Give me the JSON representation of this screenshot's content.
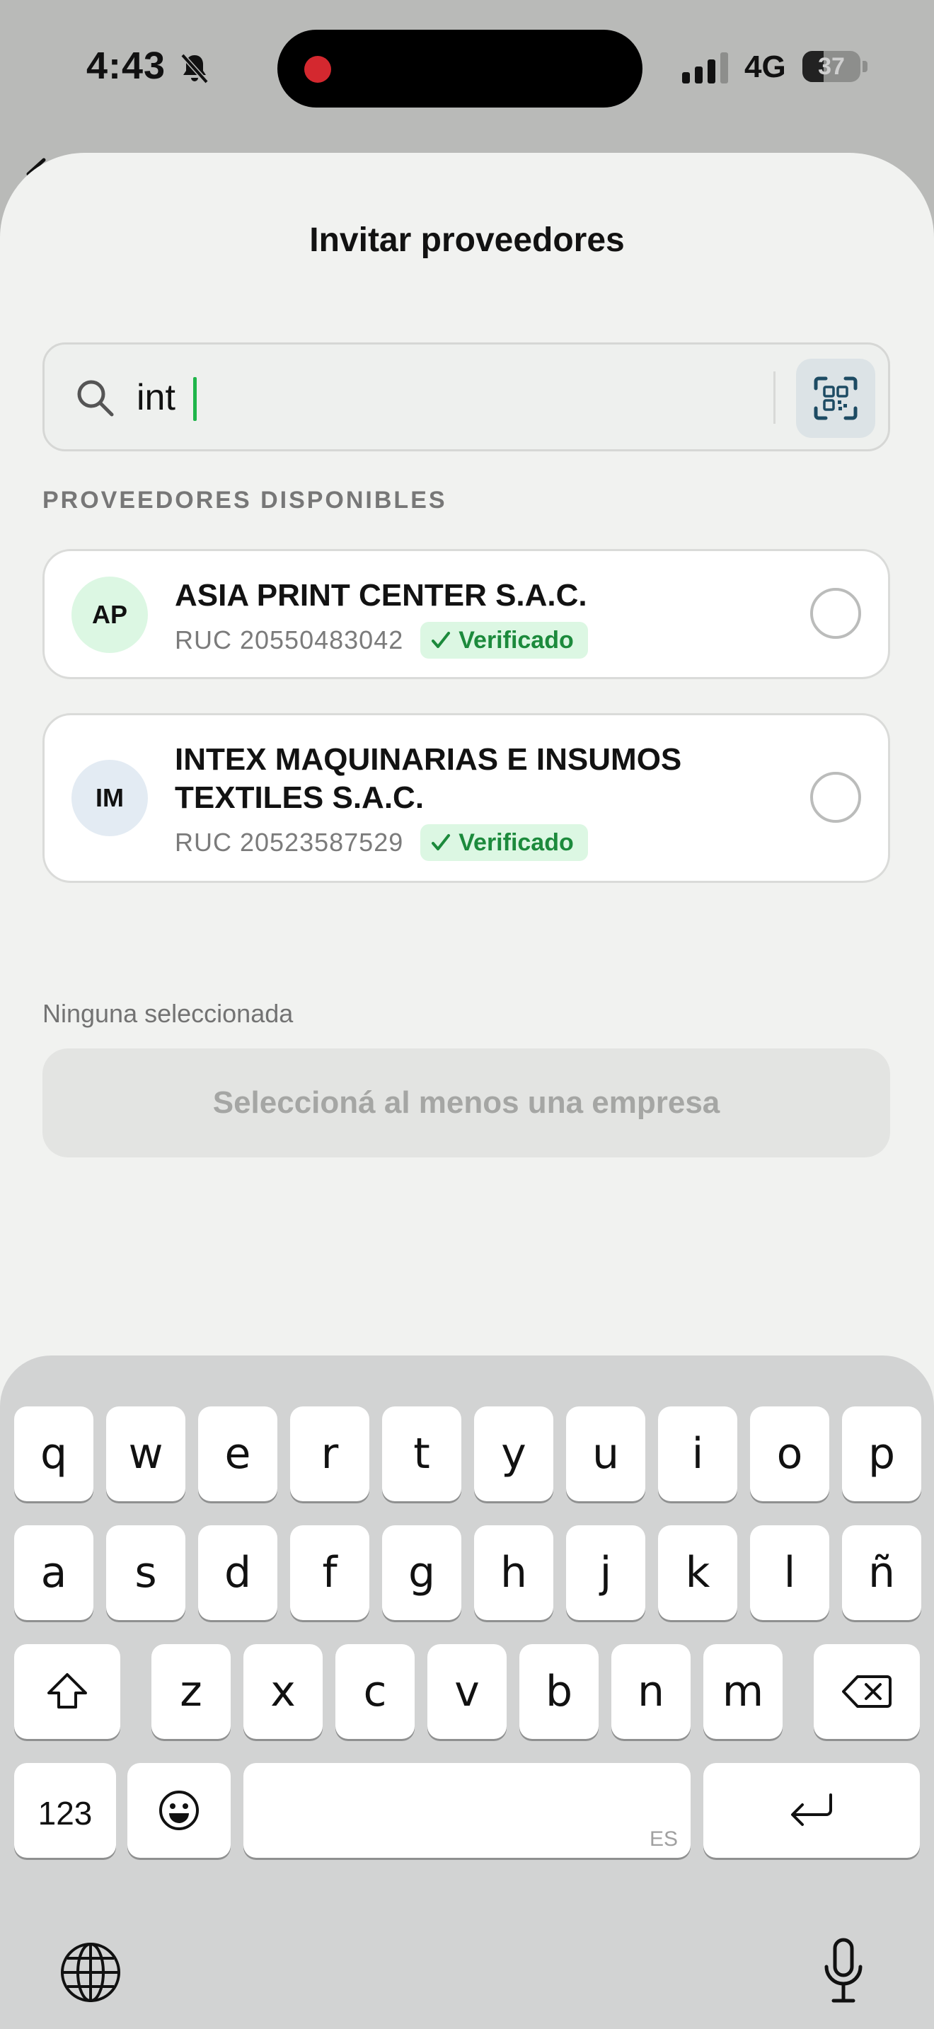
{
  "status_bar": {
    "time": "4:43",
    "network": "4G",
    "battery": "37",
    "battery_level": 0.37
  },
  "sheet": {
    "title": "Invitar proveedores",
    "search": {
      "value": "int",
      "placeholder": ""
    },
    "section_label": "PROVEEDORES DISPONIBLES",
    "suppliers": [
      {
        "initials": "AP",
        "name": "ASIA PRINT CENTER S.A.C.",
        "ruc": "RUC 20550483042",
        "badge": "Verificado",
        "selected": false
      },
      {
        "initials": "IM",
        "name": "INTEX MAQUINARIAS E INSUMOS TEXTILES S.A.C.",
        "ruc": "RUC 20523587529",
        "badge": "Verificado",
        "selected": false
      }
    ],
    "selection_status": "Ninguna seleccionada",
    "submit_label": "Seleccioná al menos una empresa"
  },
  "keyboard": {
    "row1": [
      "q",
      "w",
      "e",
      "r",
      "t",
      "y",
      "u",
      "i",
      "o",
      "p"
    ],
    "row2": [
      "a",
      "s",
      "d",
      "f",
      "g",
      "h",
      "j",
      "k",
      "l",
      "ñ"
    ],
    "row3": [
      "z",
      "x",
      "c",
      "v",
      "b",
      "n",
      "m"
    ],
    "numbers_key": "123",
    "space_hint": "ES"
  }
}
